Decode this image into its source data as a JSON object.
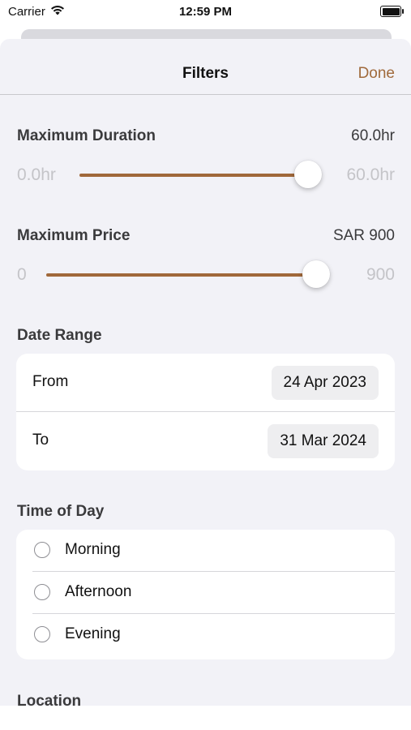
{
  "status_bar": {
    "carrier": "Carrier",
    "time": "12:59 PM"
  },
  "nav": {
    "title": "Filters",
    "done_label": "Done"
  },
  "duration": {
    "label": "Maximum Duration",
    "value": "60.0hr",
    "min": "0.0hr",
    "max": "60.0hr",
    "fraction": 1.0
  },
  "price": {
    "label": "Maximum Price",
    "value": "SAR 900",
    "min": "0",
    "max": "900",
    "fraction": 1.0
  },
  "date_range": {
    "label": "Date Range",
    "from": {
      "label": "From",
      "value": "24 Apr 2023"
    },
    "to": {
      "label": "To",
      "value": "31 Mar 2024"
    }
  },
  "time_of_day": {
    "label": "Time of Day",
    "options": [
      {
        "label": "Morning",
        "selected": false
      },
      {
        "label": "Afternoon",
        "selected": false
      },
      {
        "label": "Evening",
        "selected": false
      }
    ]
  },
  "location": {
    "label": "Location"
  },
  "colors": {
    "accent": "#a06a3c",
    "track": "#a0683a",
    "background": "#f2f2f7"
  }
}
